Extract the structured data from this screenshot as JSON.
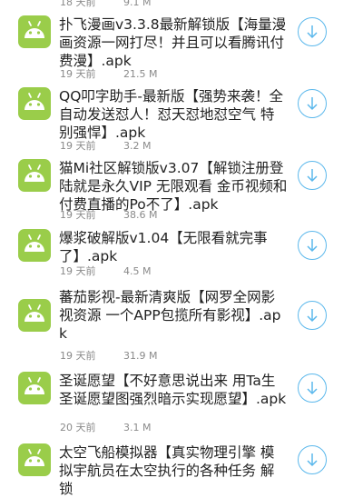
{
  "partial_top": {
    "time": "18 天前",
    "size": "9.1 M"
  },
  "apps": [
    {
      "title": "扑飞漫画v3.3.8最新解锁版【海量漫画资源一网打尽！并且可以看腾讯付费漫】.apk",
      "time": "19 天前",
      "size": "21.5 M"
    },
    {
      "title": "QQ叩字助手-最新版【强势来袭！全自动发送怼人！怼天怼地怼空气 特别强悍】.apk",
      "time": "19 天前",
      "size": "3.2 M"
    },
    {
      "title": "猫Mi社区解锁版v3.07【解锁注册登陆就是永久VIP 无限观看 金币视频和付费直播的Po不了】.apk",
      "time": "19 天前",
      "size": "38.6 M"
    },
    {
      "title": "爆浆破解版v1.04【无限看就完事了】.apk",
      "time": "19 天前",
      "size": "4.5 M"
    },
    {
      "title": "蕃茄影视-最新清爽版【网罗全网影视资源 一个APP包揽所有影视】.apk",
      "time": "19 天前",
      "size": "31.9 M"
    },
    {
      "title": "圣诞愿望【不好意思说出来 用Ta生圣诞愿望图强烈暗示实现愿望】.apk",
      "time": "20 天前",
      "size": "3.1 M"
    },
    {
      "title": "太空飞船模拟器【真实物理引擎 模拟宇航员在太空执行的各种任务 解锁",
      "time": "",
      "size": ""
    }
  ],
  "icons": {
    "app": "android-icon",
    "download": "download-arrow-icon"
  },
  "colors": {
    "android_green": "#9acd4a",
    "download_blue": "#5bb8ec",
    "meta_gray": "#8a8a8a"
  }
}
